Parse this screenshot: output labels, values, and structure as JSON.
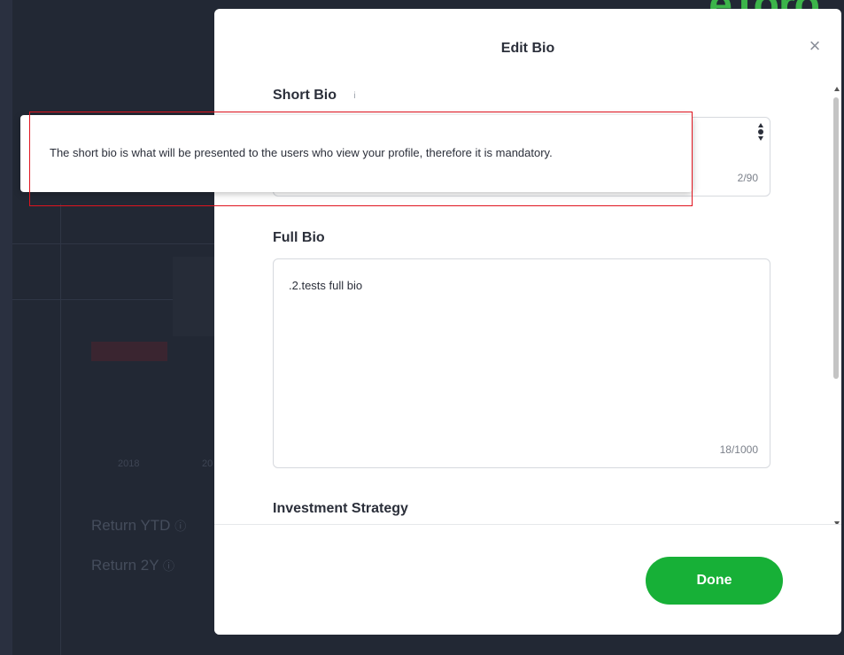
{
  "background": {
    "logo_text": "eToro",
    "stat_labels": [
      "Return YTD",
      "Return 2Y"
    ],
    "axis_years": [
      "2018",
      "20"
    ]
  },
  "modal": {
    "title": "Edit Bio",
    "close_icon": "close-icon",
    "short_bio": {
      "label": "Short Bio",
      "info_icon": "info-icon",
      "counter": "2/90"
    },
    "full_bio": {
      "label": "Full Bio",
      "value": ".2.tests full bio",
      "counter": "18/1000"
    },
    "investment_strategy": {
      "label": "Investment Strategy"
    },
    "done_label": "Done"
  },
  "tooltip": {
    "text": "The short bio is what will be presented to the users who view your profile, therefore it is mandatory."
  },
  "colors": {
    "overlay": "#222834",
    "primary_green": "#17b037",
    "highlight_red": "#e0141e"
  }
}
